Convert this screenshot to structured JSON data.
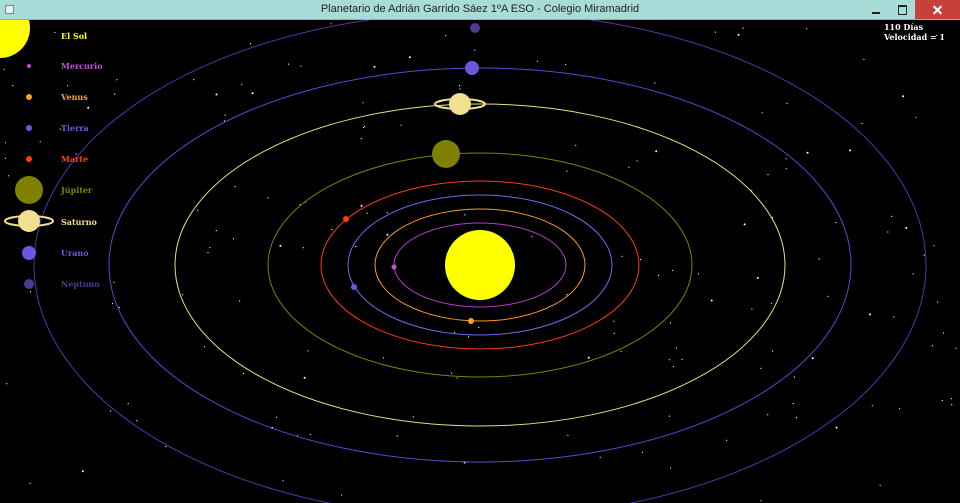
{
  "window": {
    "title": "Planetario de Adrián Garrido Sáez 1ºA ESO - Colegio Miramadrid"
  },
  "info": {
    "days": "110 Días",
    "speed": "Velocidad = 1"
  },
  "legend": [
    {
      "label": "El Sol",
      "color": "#ffff00",
      "icon": "sun-icon"
    },
    {
      "label": "Mercurio",
      "color": "#c050d8",
      "icon": "mercury-icon"
    },
    {
      "label": "Venus",
      "color": "#ffa020",
      "icon": "venus-icon"
    },
    {
      "label": "Tierra",
      "color": "#6060e0",
      "icon": "earth-icon"
    },
    {
      "label": "Marte",
      "color": "#ff4000",
      "icon": "mars-icon"
    },
    {
      "label": "Júpiter",
      "color": "#808000",
      "icon": "jupiter-icon"
    },
    {
      "label": "Saturno",
      "color": "#f0e090",
      "icon": "saturn-icon"
    },
    {
      "label": "Urano",
      "color": "#6a58e0",
      "icon": "uranus-icon"
    },
    {
      "label": "Neptuno",
      "color": "#4a3a90",
      "icon": "neptune-icon"
    }
  ],
  "colors": {
    "background": "#000000",
    "sun": "#ffff00",
    "orbit_mercury": "#b040c8",
    "orbit_venus": "#ff9a20",
    "orbit_earth": "#6a6ae8",
    "orbit_mars": "#ff3a10",
    "orbit_jupiter": "#808000",
    "orbit_saturn": "#e8e080",
    "orbit_uranus": "#5a48d0",
    "orbit_neptune": "#4a3aa8"
  }
}
